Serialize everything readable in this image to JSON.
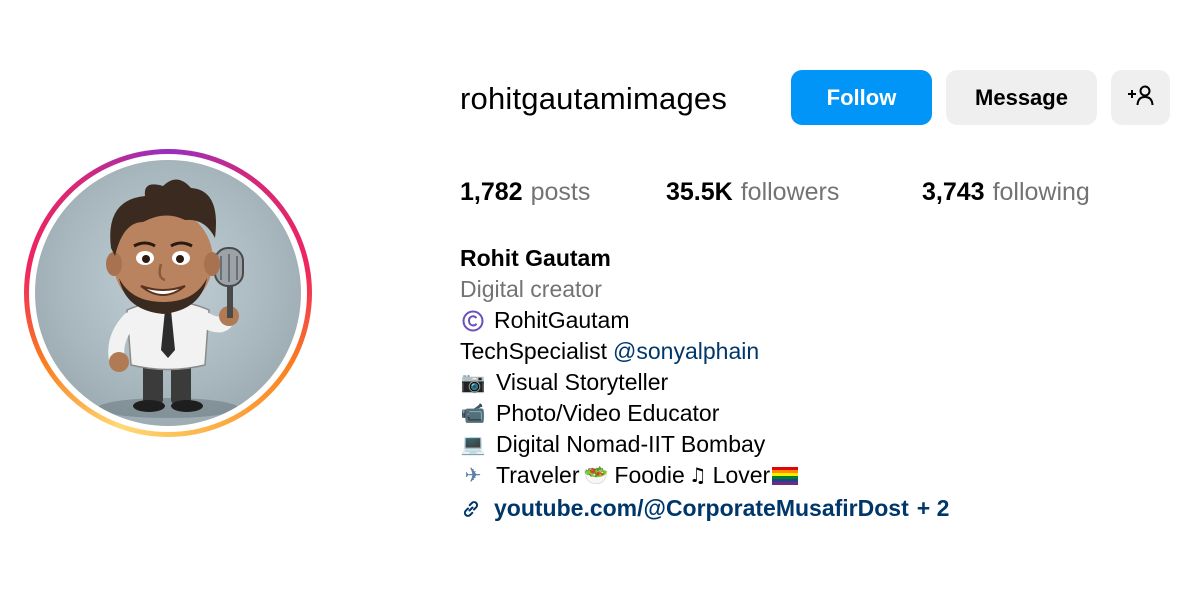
{
  "profile": {
    "username": "rohitgautamimages",
    "buttons": {
      "follow": "Follow",
      "message": "Message",
      "add_user_icon": "add-person-icon"
    },
    "stats": {
      "posts_count": "1,782",
      "posts_label": "posts",
      "followers_count": "35.5K",
      "followers_label": "followers",
      "following_count": "3,743",
      "following_label": "following"
    },
    "bio": {
      "full_name": "Rohit Gautam",
      "category": "Digital creator",
      "lines": [
        {
          "icon": "copyright-icon",
          "glyph": "©",
          "text": "RohitGautam"
        },
        {
          "text": "TechSpecialist",
          "mention": "@sonyalphain"
        },
        {
          "icon": "camera-icon",
          "glyph": "📷",
          "text": "Visual Storyteller"
        },
        {
          "icon": "video-camera-icon",
          "glyph": "📹",
          "text": "Photo/Video Educator"
        },
        {
          "icon": "laptop-icon",
          "glyph": "💻",
          "text": "Digital Nomad-IIT Bombay"
        },
        {
          "icon": "airplane-icon",
          "glyph": "✈",
          "text": "Traveler",
          "food_glyph": "🥗",
          "text2": "Foodie",
          "music_glyph": "♫",
          "text3": "Lover",
          "flag_icon": "pride-flag-icon"
        }
      ],
      "link": {
        "icon": "link-icon",
        "text": "youtube.com/@CorporateMusafirDost",
        "more": "+ 2"
      }
    },
    "colors": {
      "follow_button": "#0095f6",
      "secondary_button": "#efefef",
      "muted_text": "#737373",
      "link_text": "#00376b"
    }
  }
}
